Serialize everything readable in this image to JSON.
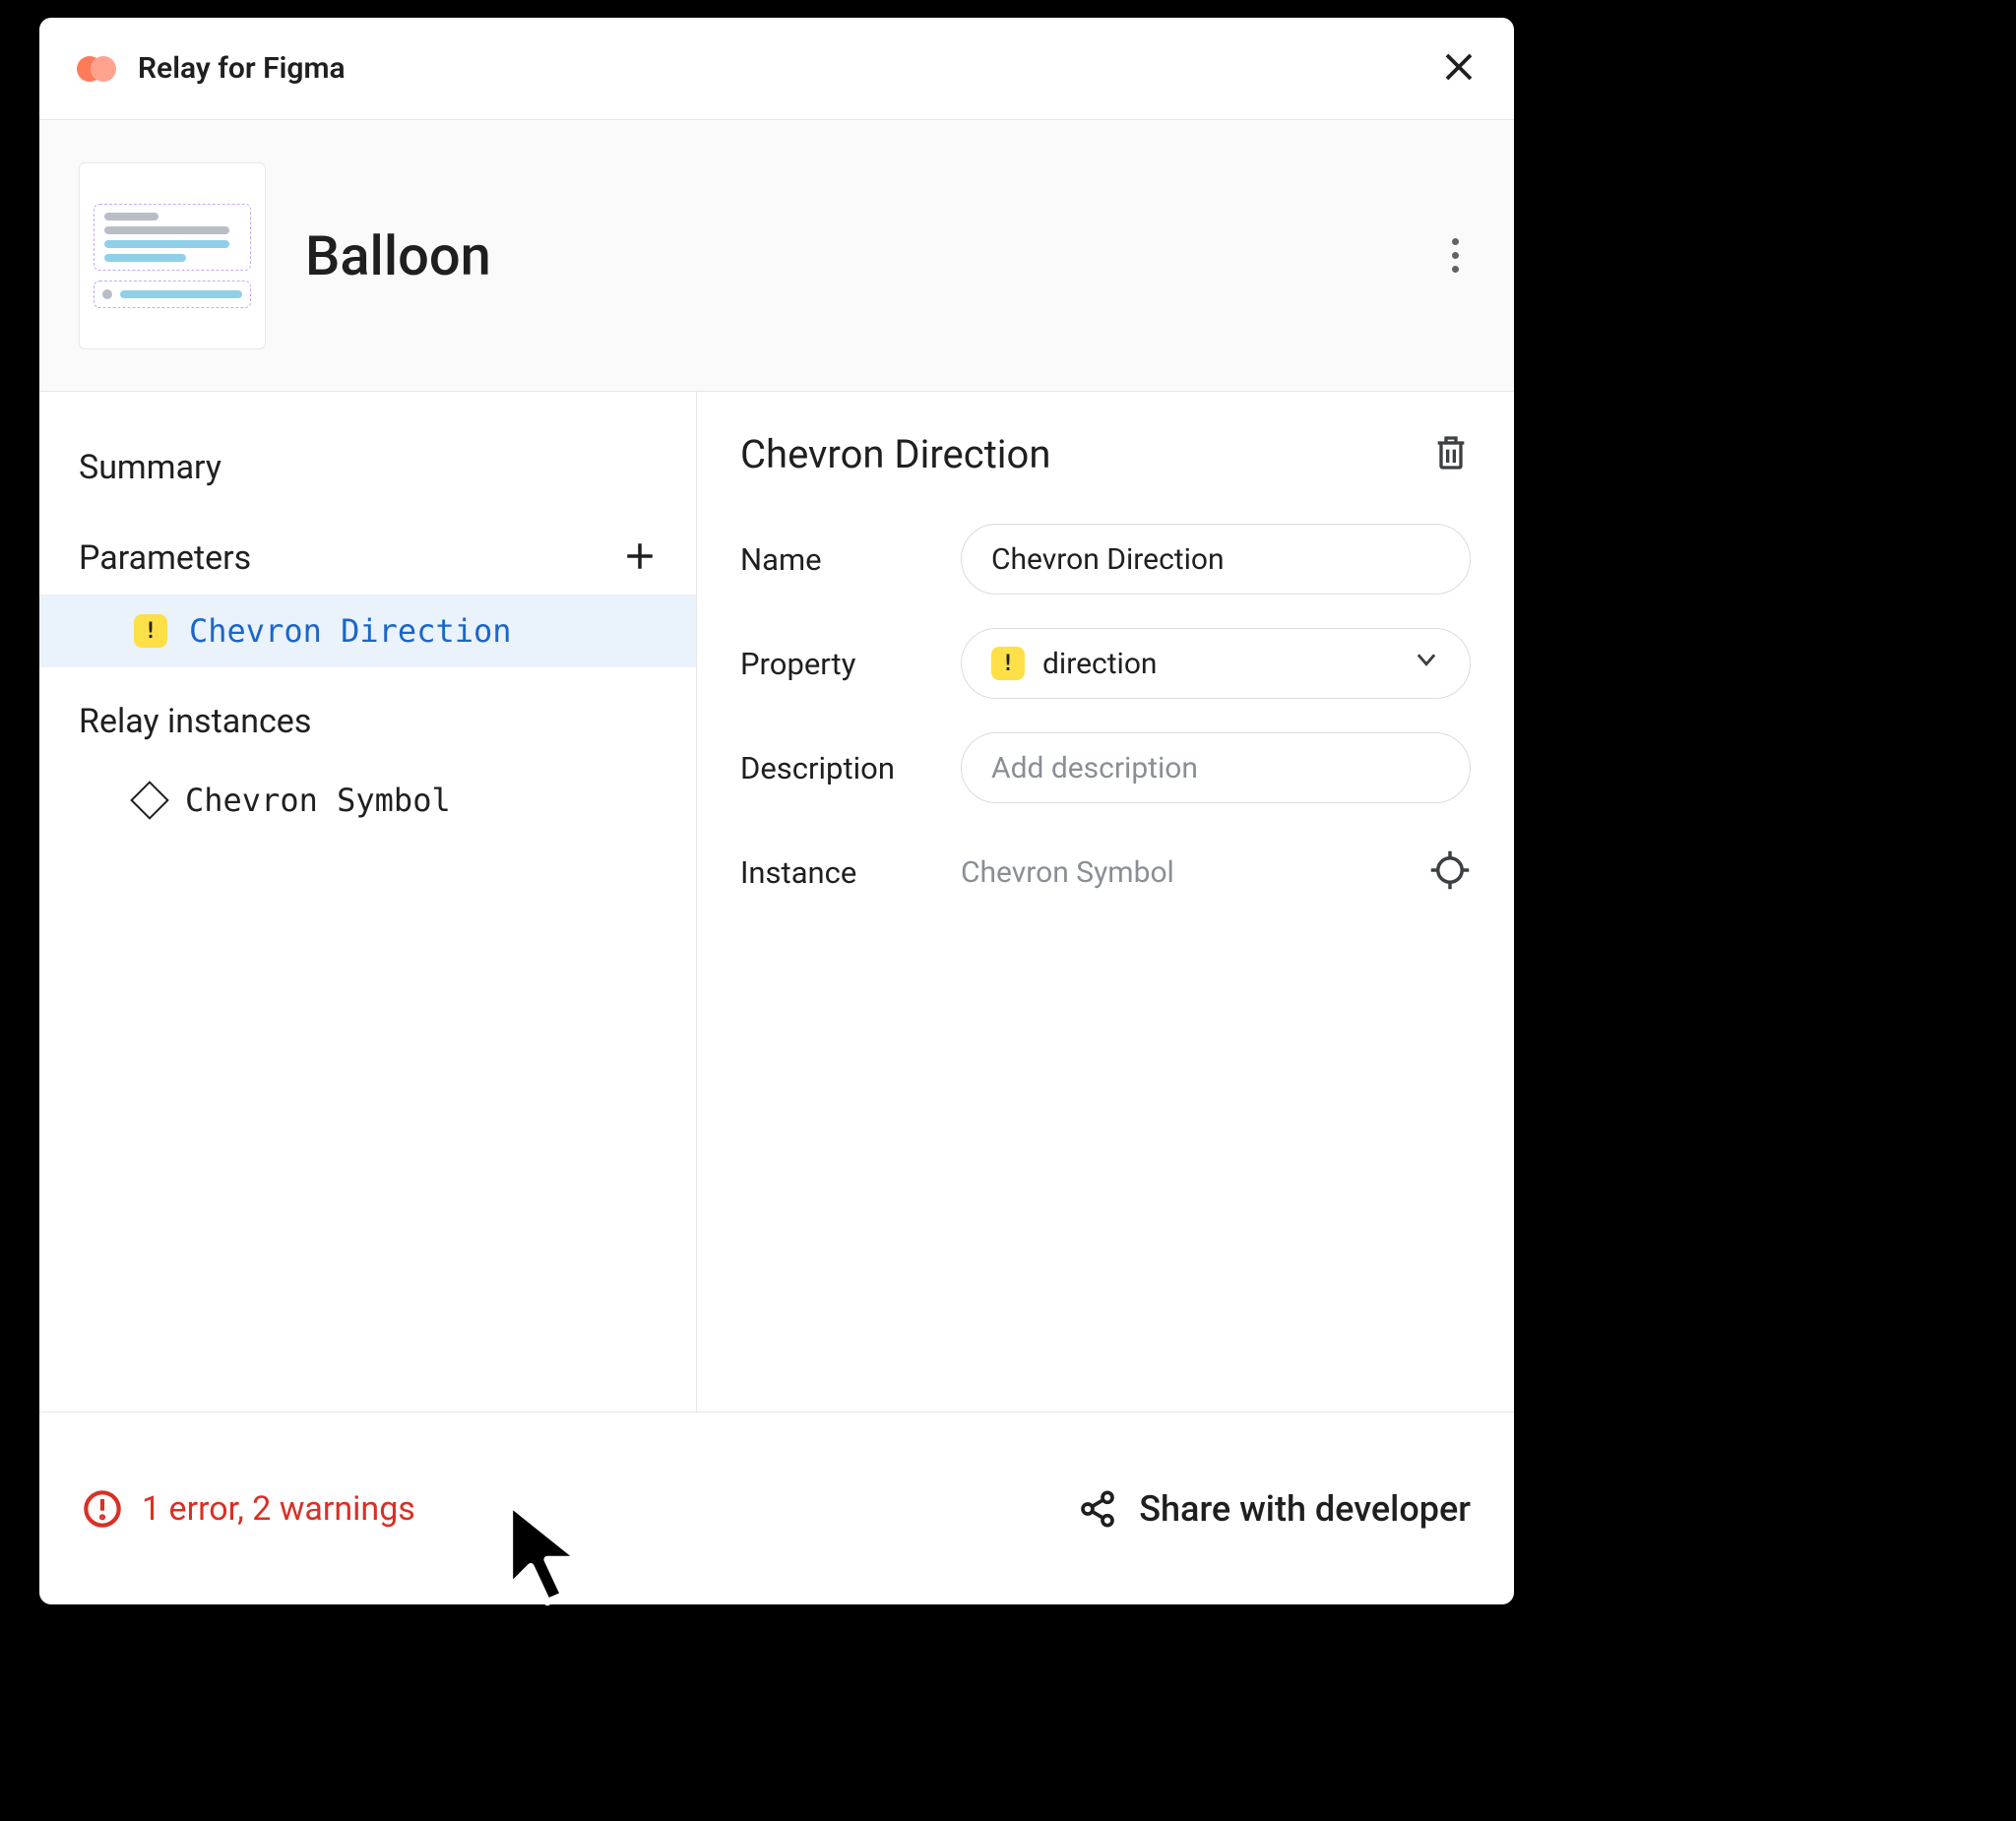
{
  "titlebar": {
    "title": "Relay for Figma"
  },
  "header": {
    "component_name": "Balloon"
  },
  "sidebar": {
    "summary_label": "Summary",
    "parameters_label": "Parameters",
    "relay_instances_label": "Relay instances",
    "parameters": [
      {
        "label": "Chevron Direction",
        "has_warning": true,
        "selected": true
      }
    ],
    "instances": [
      {
        "label": "Chevron Symbol"
      }
    ]
  },
  "detail": {
    "title": "Chevron Direction",
    "fields": {
      "name_label": "Name",
      "name_value": "Chevron Direction",
      "property_label": "Property",
      "property_value": "direction",
      "property_has_warning": true,
      "description_label": "Description",
      "description_placeholder": "Add description",
      "description_value": "",
      "instance_label": "Instance",
      "instance_value": "Chevron Symbol"
    }
  },
  "footer": {
    "errors_text": "1 error, 2 warnings",
    "share_label": "Share with developer"
  }
}
